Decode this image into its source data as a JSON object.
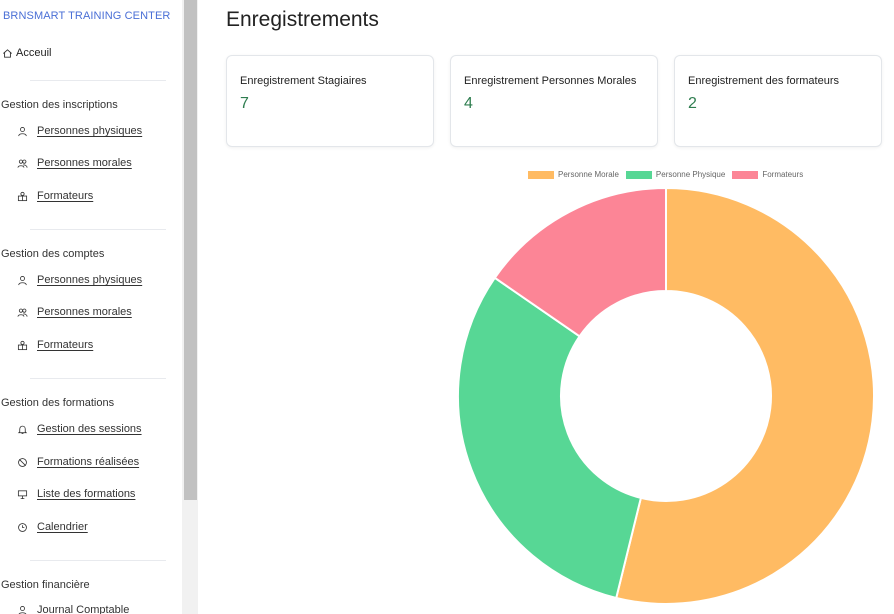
{
  "sidebar": {
    "brand": "BRNSMART TRAINING CENTER",
    "home": "Acceuil",
    "sections": [
      {
        "title": "Gestion des inscriptions",
        "items": [
          {
            "label": "Personnes physiques",
            "icon": "person-icon"
          },
          {
            "label": "Personnes morales",
            "icon": "people-icon"
          },
          {
            "label": "Formateurs",
            "icon": "trainer-icon"
          }
        ]
      },
      {
        "title": "Gestion des comptes",
        "items": [
          {
            "label": "Personnes physiques",
            "icon": "person-icon"
          },
          {
            "label": "Personnes morales",
            "icon": "people-icon"
          },
          {
            "label": "Formateurs",
            "icon": "trainer-icon"
          }
        ]
      },
      {
        "title": "Gestion des formations",
        "items": [
          {
            "label": "Gestion des sessions",
            "icon": "bell-icon"
          },
          {
            "label": "Formations réalisées",
            "icon": "check-badge-icon"
          },
          {
            "label": "Liste des formations",
            "icon": "presentation-icon"
          },
          {
            "label": "Calendrier",
            "icon": "clock-icon"
          }
        ]
      },
      {
        "title": "Gestion financière",
        "items": [
          {
            "label": "Journal Comptable",
            "icon": "person-icon"
          }
        ]
      }
    ]
  },
  "main": {
    "title": "Enregistrements",
    "cards": [
      {
        "label": "Enregistrement Stagiaires",
        "value": "7"
      },
      {
        "label": "Enregistrement Personnes Morales",
        "value": "4"
      },
      {
        "label": "Enregistrement des formateurs",
        "value": "2"
      }
    ]
  },
  "chart_data": {
    "type": "pie",
    "variant": "doughnut",
    "categories": [
      "Personne Morale",
      "Personne Physique",
      "Formateurs"
    ],
    "values": [
      7,
      4,
      2
    ],
    "colors": [
      "#ffbb63",
      "#57d795",
      "#fc8596"
    ],
    "legend": "top"
  }
}
